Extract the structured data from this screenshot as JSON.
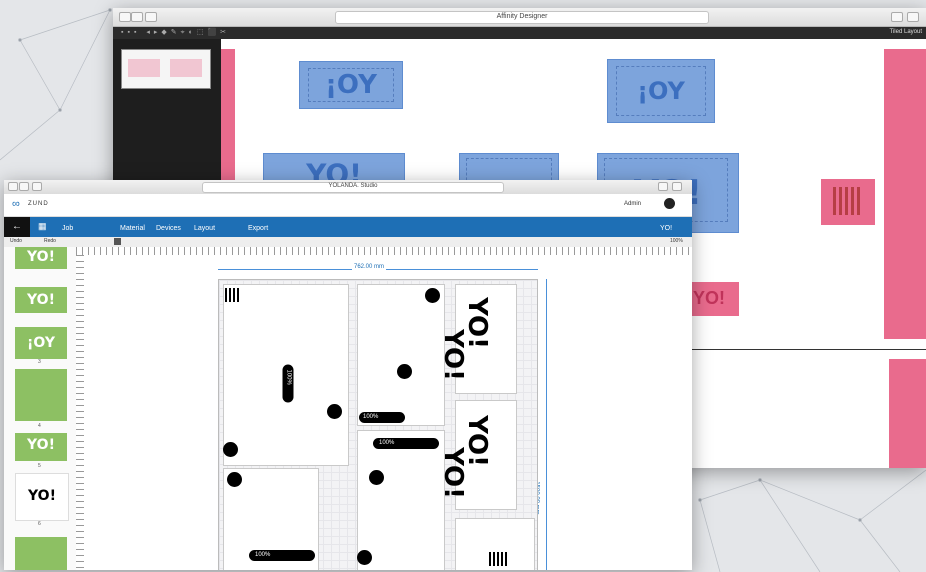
{
  "back_window": {
    "address": "Affinity Designer",
    "top_right_text": "Tiled Layout",
    "blocks_flipped": [
      "¡OY",
      "¡OY"
    ],
    "blocks_normal": [
      "YO!",
      "YO!",
      "YO!",
      "YO!"
    ]
  },
  "front_window": {
    "address": "YOLANDA. Studio",
    "logo_text": "ZUND",
    "user_text": "Admin",
    "back_label": "←",
    "nav": [
      "Job",
      "Material",
      "Devices",
      "Layout",
      "Export"
    ],
    "nav_right": "YO!",
    "sub_toolbar": [
      "Undo",
      "Redo"
    ],
    "zoom_value": "100%",
    "width_label": "762.00 mm",
    "height_label": "1500.00 mm",
    "pill_labels": [
      "100%",
      "100%",
      "100%",
      "100%"
    ],
    "thumbs": [
      {
        "text": "YO!",
        "num": ""
      },
      {
        "text": "YO!",
        "num": ""
      },
      {
        "text": "¡OY",
        "num": "3"
      },
      {
        "text": "",
        "num": "4"
      },
      {
        "text": "YO!",
        "num": "5"
      },
      {
        "text": "YO!",
        "num": "6"
      },
      {
        "text": "",
        "num": "7"
      }
    ],
    "card_texts": [
      "YO!",
      "YO!",
      "YO!",
      "YO!"
    ]
  },
  "colors": {
    "nav_blue": "#1e6fb5",
    "selection_blue": "#7da4dc",
    "pink": "#e96b8d",
    "thumb_green": "#8dc063"
  }
}
